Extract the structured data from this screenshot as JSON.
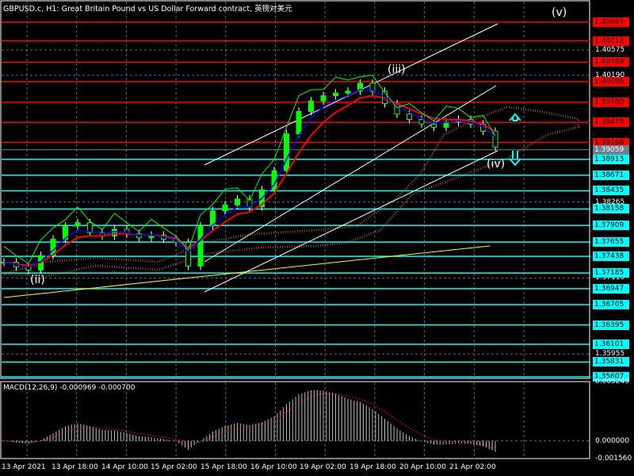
{
  "header": {
    "title": "GBPUSD.c, H1:  Great Britain Pound vs US Dollar Forward contract, 英镑对美元"
  },
  "colors": {
    "background": "#000000",
    "resistance": "#ff0000",
    "support": "#00ffff",
    "current": "#708090",
    "grid": "#5f6b7a",
    "channel": "#ffffff",
    "trendline_yellow": "#ffff00",
    "green_line": "#00ff00"
  },
  "price_axis": {
    "range": [
      1.35607,
      1.40997
    ],
    "grid_labels": [
      "1.40575",
      "1.40190",
      "1.38265",
      "1.37110",
      "1.35955"
    ],
    "levels": [
      {
        "price": "1.40997",
        "type": "resistance"
      },
      {
        "price": "1.40712",
        "type": "resistance"
      },
      {
        "price": "1.40389",
        "type": "resistance"
      },
      {
        "price": "1.40096",
        "type": "resistance"
      },
      {
        "price": "1.39780",
        "type": "resistance"
      },
      {
        "price": "1.39475",
        "type": "resistance"
      },
      {
        "price": "1.39168",
        "type": "resistance"
      },
      {
        "price": "1.39059",
        "type": "current"
      },
      {
        "price": "1.38913",
        "type": "support"
      },
      {
        "price": "1.38671",
        "type": "support"
      },
      {
        "price": "1.38435",
        "type": "support"
      },
      {
        "price": "1.38158",
        "type": "support"
      },
      {
        "price": "1.37909",
        "type": "support"
      },
      {
        "price": "1.37655",
        "type": "support"
      },
      {
        "price": "1.37438",
        "type": "support"
      },
      {
        "price": "1.37185",
        "type": "support"
      },
      {
        "price": "1.36947",
        "type": "support"
      },
      {
        "price": "1.36705",
        "type": "support"
      },
      {
        "price": "1.36395",
        "type": "support"
      },
      {
        "price": "1.36101",
        "type": "support"
      },
      {
        "price": "1.35831",
        "type": "support"
      },
      {
        "price": "1.35607",
        "type": "support"
      }
    ]
  },
  "time_axis": [
    "13 Apr 2021",
    "13 Apr 18:00",
    "14 Apr 10:00",
    "15 Apr 02:00",
    "15 Apr 18:00",
    "16 Apr 10:00",
    "19 Apr 02:00",
    "19 Apr 18:00",
    "20 Apr 10:00",
    "21 Apr 02:00"
  ],
  "waves": [
    "(ii)",
    "(iii)",
    "(iv)",
    "(v)"
  ],
  "price_path": [
    1.3735,
    1.3728,
    1.3723,
    1.3745,
    1.377,
    1.379,
    1.3795,
    1.378,
    1.3775,
    1.3785,
    1.3778,
    1.3772,
    1.3776,
    1.377,
    1.3765,
    1.3729,
    1.379,
    1.3813,
    1.3822,
    1.3831,
    1.3819,
    1.3845,
    1.3874,
    1.393,
    1.3964,
    1.398,
    1.3988,
    1.3992,
    1.3995,
    1.4007,
    1.3995,
    1.3976,
    1.396,
    1.3952,
    1.3945,
    1.394,
    1.3948,
    1.3952,
    1.3945,
    1.3934,
    1.391
  ],
  "macd": {
    "title": "MACD(12,26,9) -0.000969 -0.000700",
    "axis_labels": [
      "0.005249",
      "0.000000",
      "-0.001560"
    ],
    "range": [
      -0.00156,
      0.005249
    ]
  }
}
